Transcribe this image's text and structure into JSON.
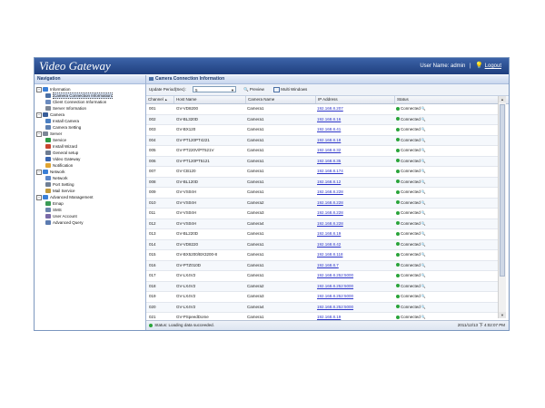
{
  "app": {
    "title": "Video Gateway",
    "user_label": "User Name: admin",
    "separator": "|",
    "logout_label": "Logout"
  },
  "nav": {
    "title": "Navigation",
    "items": [
      {
        "label": "Information",
        "level": 0,
        "icon": "info-icon",
        "color": "#3b7fd6"
      },
      {
        "label": "Camera Connection Information",
        "level": 1,
        "icon": "camera-icon",
        "color": "#4a6fa5",
        "selected": true
      },
      {
        "label": "Client Connection Information",
        "level": 1,
        "icon": "client-icon",
        "color": "#6a8bbf"
      },
      {
        "label": "Server Information",
        "level": 1,
        "icon": "server-icon",
        "color": "#7d8796"
      },
      {
        "label": "Camera",
        "level": 0,
        "icon": "camera-folder-icon",
        "color": "#3a5f99"
      },
      {
        "label": "Install Camera",
        "level": 1,
        "icon": "install-camera-icon",
        "color": "#4b7fc2"
      },
      {
        "label": "Camera Setting",
        "level": 1,
        "icon": "camera-setting-icon",
        "color": "#5d7fb0"
      },
      {
        "label": "Server",
        "level": 0,
        "icon": "server-folder-icon",
        "color": "#7d8796"
      },
      {
        "label": "Service",
        "level": 1,
        "icon": "service-icon",
        "color": "#2d9a45"
      },
      {
        "label": "Install Wizard",
        "level": 1,
        "icon": "wizard-icon",
        "color": "#c9452f"
      },
      {
        "label": "General setup",
        "level": 1,
        "icon": "general-setup-icon",
        "color": "#6e7c91"
      },
      {
        "label": "Video Gateway",
        "level": 1,
        "icon": "video-gateway-icon",
        "color": "#3a66b0"
      },
      {
        "label": "Notification",
        "level": 1,
        "icon": "notification-icon",
        "color": "#e0a431"
      },
      {
        "label": "Network",
        "level": 0,
        "icon": "network-icon",
        "color": "#3b7fd6"
      },
      {
        "label": "Network",
        "level": 1,
        "icon": "network-item-icon",
        "color": "#5a86c9"
      },
      {
        "label": "Port Setting",
        "level": 1,
        "icon": "port-setting-icon",
        "color": "#6f7f95"
      },
      {
        "label": "Mail Service",
        "level": 1,
        "icon": "mail-icon",
        "color": "#c39a3b"
      },
      {
        "label": "Advanced Management",
        "level": 0,
        "icon": "advanced-icon",
        "color": "#3b7fd6"
      },
      {
        "label": "Emap",
        "level": 1,
        "icon": "emap-icon",
        "color": "#3a9b55"
      },
      {
        "label": "SMS",
        "level": 1,
        "icon": "sms-icon",
        "color": "#6b84ad"
      },
      {
        "label": "User Account",
        "level": 1,
        "icon": "user-account-icon",
        "color": "#7a6aa8"
      },
      {
        "label": "Advanced Query",
        "level": 1,
        "icon": "query-icon",
        "color": "#5b7bb0"
      }
    ]
  },
  "panel": {
    "title": "Camera Connection Information",
    "update_label": "Update Period(Sec):",
    "update_value": "5",
    "preview_label": "Preview",
    "multi_label": "Multi Windows",
    "columns": [
      "Channel",
      "Host Name",
      "Camera Name",
      "IP Address",
      "Status"
    ],
    "sort_indicator": "▲",
    "rows": [
      {
        "channel": "001",
        "host": "GV-VD8200",
        "camera": "Camera1",
        "ip": "192.168.8.207",
        "status": "Connected"
      },
      {
        "channel": "002",
        "host": "GV-BL320D",
        "camera": "Camera1",
        "ip": "192.168.8.16",
        "status": "Connected"
      },
      {
        "channel": "003",
        "host": "GV-BX120",
        "camera": "Camera1",
        "ip": "192.168.8.41",
        "status": "Connected"
      },
      {
        "channel": "004",
        "host": "GV-PT120PT4221",
        "camera": "Camera1",
        "ip": "192.168.8.18",
        "status": "Connected"
      },
      {
        "channel": "005",
        "host": "GV-PT220V/PT521V",
        "camera": "Camera1",
        "ip": "192.168.8.32",
        "status": "Connected"
      },
      {
        "channel": "006",
        "host": "GV-PT120PT5121",
        "camera": "Camera1",
        "ip": "192.168.8.35",
        "status": "Connected"
      },
      {
        "channel": "007",
        "host": "GV-CB120",
        "camera": "Camera1",
        "ip": "192.168.8.174",
        "status": "Connected"
      },
      {
        "channel": "008",
        "host": "GV-BL120D",
        "camera": "Camera1",
        "ip": "192.168.8.12",
        "status": "Connected"
      },
      {
        "channel": "009",
        "host": "GV-VS04H",
        "camera": "Camera1",
        "ip": "192.168.8.228",
        "status": "Connected"
      },
      {
        "channel": "010",
        "host": "GV-VS04H",
        "camera": "Camera2",
        "ip": "192.168.8.228",
        "status": "Connected"
      },
      {
        "channel": "011",
        "host": "GV-VS04H",
        "camera": "Camera3",
        "ip": "192.168.8.228",
        "status": "Connected"
      },
      {
        "channel": "012",
        "host": "GV-VS04H",
        "camera": "Camera4",
        "ip": "192.168.8.228",
        "status": "Connected"
      },
      {
        "channel": "013",
        "host": "GV-BL220D",
        "camera": "Camera1",
        "ip": "192.168.8.19",
        "status": "Connected"
      },
      {
        "channel": "014",
        "host": "GV-VD8220",
        "camera": "Camera1",
        "ip": "192.168.8.42",
        "status": "Connected"
      },
      {
        "channel": "015",
        "host": "GV-BX5200/BX3200-8",
        "camera": "Camera1",
        "ip": "192.168.8.118",
        "status": "Connected"
      },
      {
        "channel": "016",
        "host": "GV-PTZ010D",
        "camera": "Camera1",
        "ip": "192.168.8.7",
        "status": "Connected"
      },
      {
        "channel": "017",
        "host": "GV-LX4V2",
        "camera": "Camera1",
        "ip": "192.168.8.252:5000",
        "status": "Connected"
      },
      {
        "channel": "018",
        "host": "GV-LX4V2",
        "camera": "Camera2",
        "ip": "192.168.8.252:5000",
        "status": "Connected"
      },
      {
        "channel": "019",
        "host": "GV-LX4V2",
        "camera": "Camera3",
        "ip": "192.168.8.252:5000",
        "status": "Connected"
      },
      {
        "channel": "020",
        "host": "GV-LX4V2",
        "camera": "Camera4",
        "ip": "192.168.8.252:5000",
        "status": "Connected"
      },
      {
        "channel": "021",
        "host": "GV-PSpeedDome",
        "camera": "Camera1",
        "ip": "192.168.8.19",
        "status": "Connected"
      }
    ]
  },
  "statusbar": {
    "status_label": "Status",
    "message": "Loading data succeeded.",
    "datetime": "2011/12/13 下 4:02:07 PM"
  },
  "colors": {
    "header": "#2a4d92",
    "connected": "#2aa43a",
    "link": "#2b33c8"
  }
}
